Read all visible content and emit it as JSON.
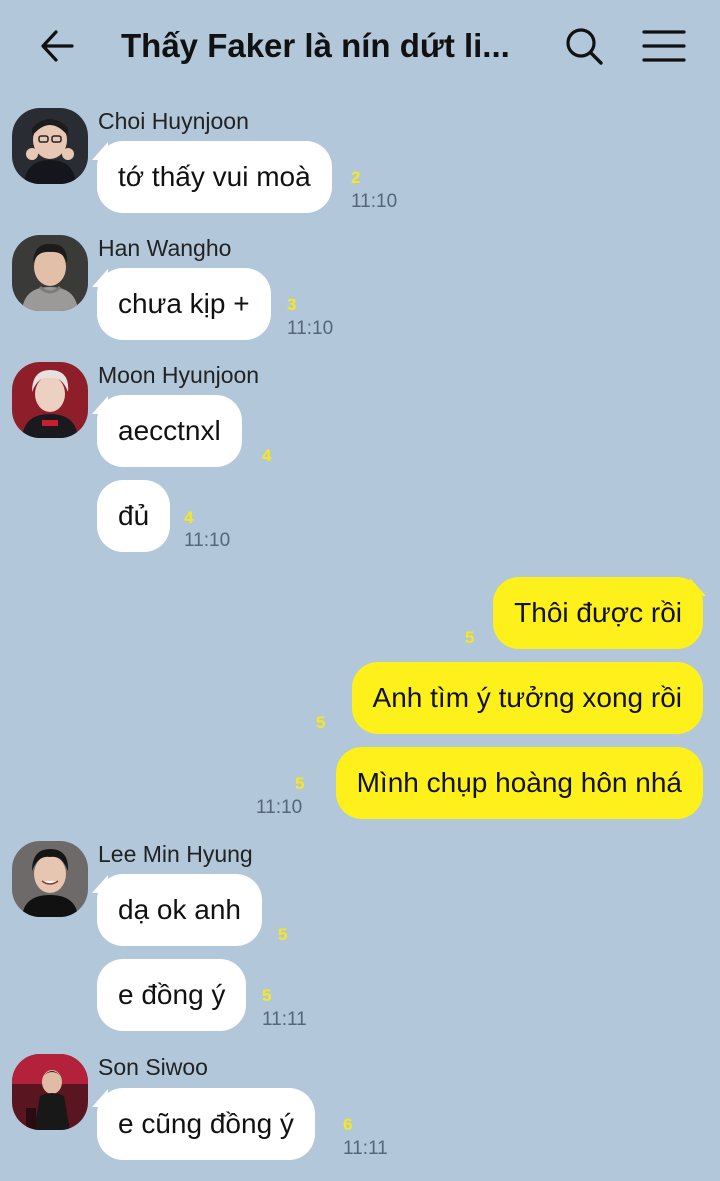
{
  "header": {
    "title": "Thấy Faker là nín dứt li...",
    "back_icon": "arrow-left-icon",
    "search_icon": "search-icon",
    "menu_icon": "hamburger-menu-icon"
  },
  "colors": {
    "background": "#b2c7da",
    "incoming_bubble": "#ffffff",
    "outgoing_bubble": "#fef01b",
    "unread_count": "#f8e71c"
  },
  "messages": [
    {
      "sender": "Choi Huynjoon",
      "text": "tớ thấy vui moà",
      "unread": "2",
      "time": "11:10"
    },
    {
      "sender": "Han Wangho",
      "text": "chưa kịp +",
      "unread": "3",
      "time": "11:10"
    },
    {
      "sender": "Moon Hyunjoon",
      "text": "aecctnxl",
      "unread": "4",
      "time": ""
    },
    {
      "sender": "",
      "text": "đủ",
      "unread": "4",
      "time": "11:10"
    },
    {
      "sender": "me",
      "text": "Thôi được rồi",
      "unread": "5",
      "time": ""
    },
    {
      "sender": "me",
      "text": "Anh tìm ý tưởng xong rồi",
      "unread": "5",
      "time": ""
    },
    {
      "sender": "me",
      "text": "Mình chụp hoàng hôn nhá",
      "unread": "5",
      "time": "11:10"
    },
    {
      "sender": "Lee Min Hyung",
      "text": "dạ ok anh",
      "unread": "5",
      "time": ""
    },
    {
      "sender": "",
      "text": "e đồng ý",
      "unread": "5",
      "time": "11:11"
    },
    {
      "sender": "Son Siwoo",
      "text": "e cũng đồng ý",
      "unread": "6",
      "time": "11:11"
    }
  ]
}
